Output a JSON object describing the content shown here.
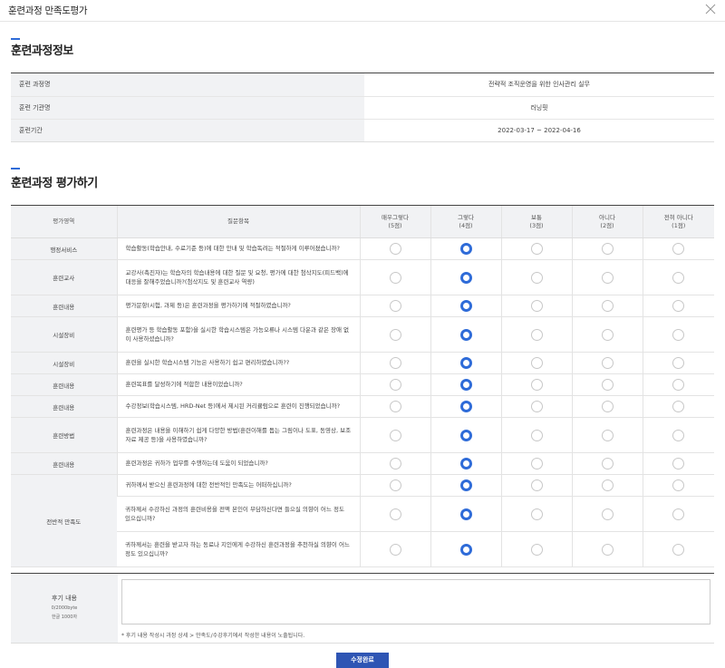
{
  "window": {
    "title": "훈련과정 만족도평가"
  },
  "info": {
    "section_title": "훈련과정정보",
    "rows": [
      {
        "label": "훈련 과정명",
        "value": "전략적 조직운영을 위한 인사관리 실무"
      },
      {
        "label": "훈련 기관명",
        "value": "러닝핏"
      },
      {
        "label": "훈련기간",
        "value": "2022-03-17 ~ 2022-04-16"
      }
    ]
  },
  "evaluation": {
    "section_title": "훈련과정 평가하기",
    "headers": {
      "area": "평가영역",
      "question": "질문항목",
      "options": [
        {
          "line1": "매우그렇다",
          "line2": "(5점)"
        },
        {
          "line1": "그렇다",
          "line2": "(4점)"
        },
        {
          "line1": "보통",
          "line2": "(3점)"
        },
        {
          "line1": "아니다",
          "line2": "(2점)"
        },
        {
          "line1": "전혀 아니다",
          "line2": "(1점)"
        }
      ]
    },
    "rows": [
      {
        "area": "행정서비스",
        "question": "학습활동(학습안내, 수료기준 등)에 대한 안내 및 학습독려는 적절하게 이루어졌습니까?",
        "selected": 1
      },
      {
        "area": "훈련교사",
        "question": "교강사(촉진자)는 학습자의 학습내용에 대한 질문 및 요청, 평가에 대한 첨삭지도(피드백)에 대응을 잘해주었습니까?(첨삭지도 및 훈련교사 역량)",
        "selected": 1
      },
      {
        "area": "훈련내용",
        "question": "평가문항(시험, 과제 등)은 훈련과정을 평가하기에 적절하였습니까?",
        "selected": 1
      },
      {
        "area": "시설장비",
        "question": "훈련평가 등 학습활동 포함)을 실시한 학습시스템은 가능오류나 시스템 다운과 같은 장애 없이 사용하셨습니까?",
        "selected": 1
      },
      {
        "area": "시설장비",
        "question": "훈련을 실시한 학습시스템 기능은 사용하기 쉽고 편리하였습니까??",
        "selected": 1
      },
      {
        "area": "훈련내용",
        "question": "훈련목표를 달성하기에 적합한 내용이었습니까?",
        "selected": 1
      },
      {
        "area": "훈련내용",
        "question": "수강정보(학습시스템, HRD-Net 등)에서 제시된 커리큘럼으로 훈련이 진행되었습니까?",
        "selected": 1
      },
      {
        "area": "훈련방법",
        "question": "훈련과정은 내용을 이해하기 쉽게 다양한 방법(훈련이해를 돕는 그림이나 도표, 동영상, 보조자료 제공 등)을 사용하였습니까?",
        "selected": 1
      },
      {
        "area": "훈련내용",
        "question": "훈련과정은 귀하가 업무를 수행하는데 도움이 되었습니까?",
        "selected": 1
      },
      {
        "area": "전반적 만족도",
        "question": "귀하께서 받으신 훈련과정에 대한 전반적인 만족도는 어떠하십니까?",
        "selected": 1
      },
      {
        "area": "",
        "question": "귀하께서 수강하신 과정의 훈련비용을 전액 본인이 부담하신다면 들으실 의향이 어느 정도 있으십니까?",
        "selected": 1
      },
      {
        "area": "",
        "question": "귀하께서는 훈련을 받고자 하는 동료나 지인에게 수강하신 훈련과정을 추천하실 의향이 어느 정도 있으십니까?",
        "selected": 1
      }
    ]
  },
  "review": {
    "label": "후기 내용",
    "limit": "0/2000byte",
    "limit_note": "한글 1000자",
    "value": "",
    "note": "* 후기 내용 작성시 과정 상세 > 만족도/수강후기에서 작성한 내용이 노출됩니다."
  },
  "submit_label": "수정완료",
  "colors": {
    "accent": "#2e6bd8",
    "button": "#2e55b4",
    "header_bg": "#f1f2f4"
  }
}
